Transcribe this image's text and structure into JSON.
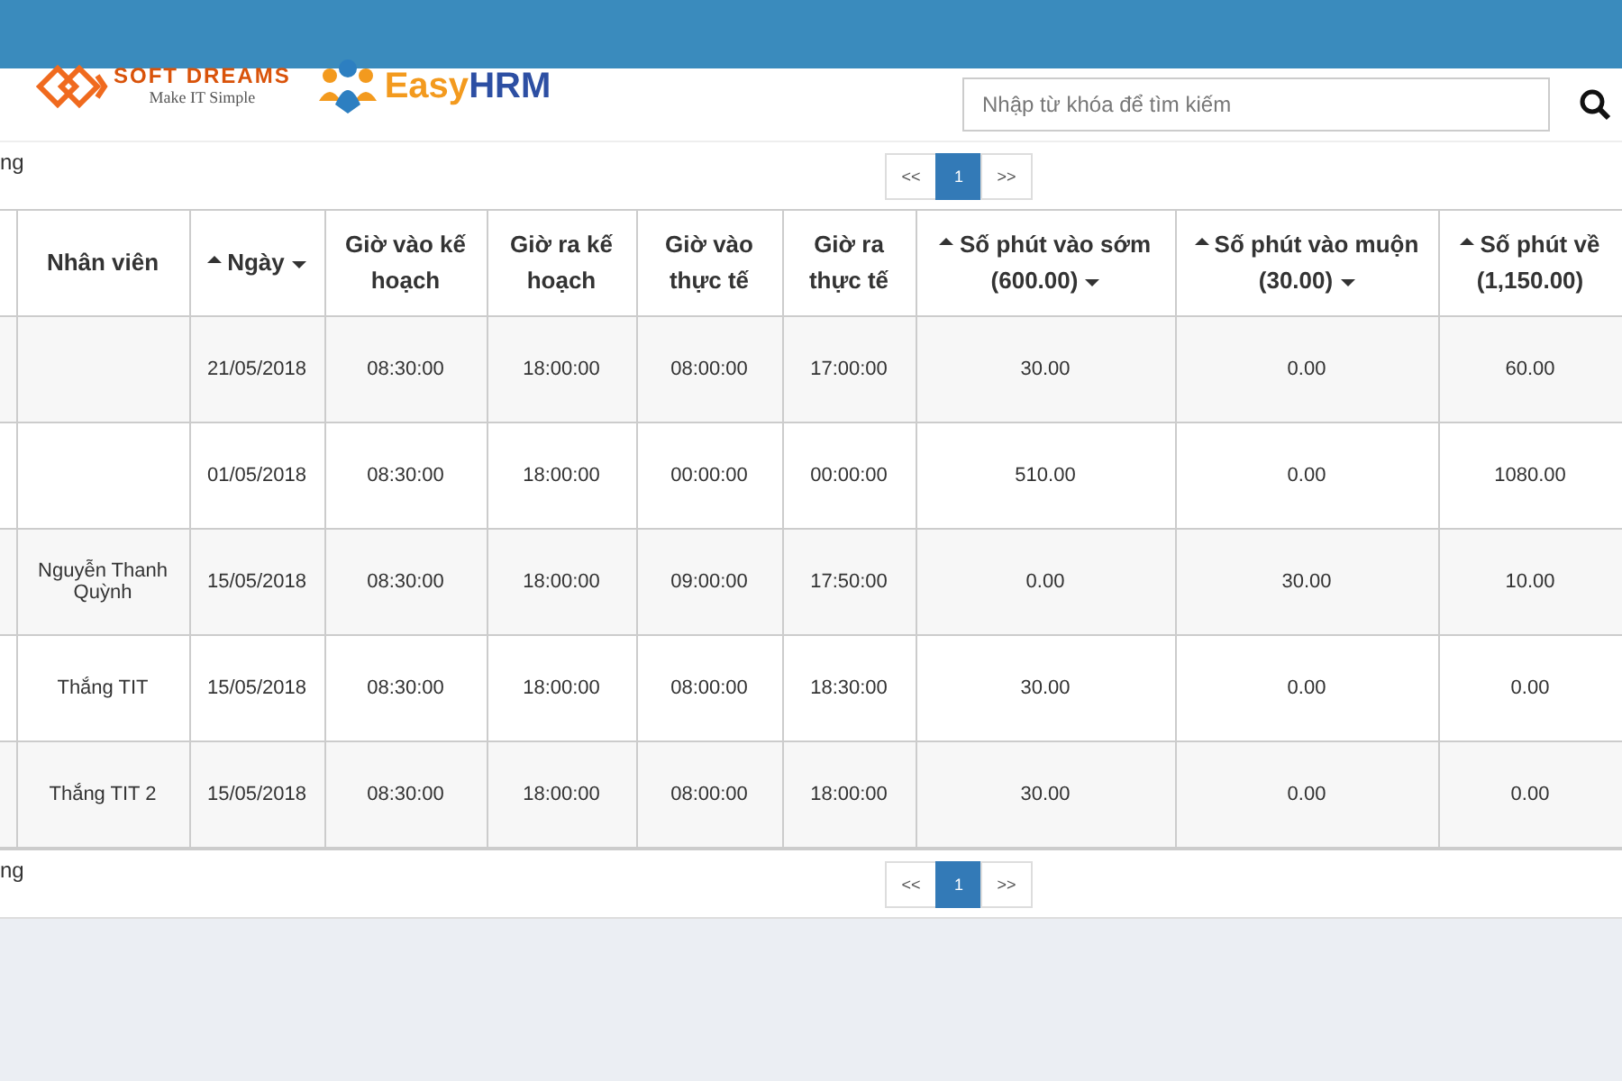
{
  "header": {
    "softdreams": {
      "name": "SOFT DREAMS",
      "tagline": "Make IT Simple"
    },
    "easyhrm": {
      "name_a": "Easy",
      "name_b": "HRM"
    }
  },
  "search": {
    "placeholder": "Nhập từ khóa để tìm kiếm"
  },
  "top_bar": {
    "status_text": "ng",
    "pagination": [
      {
        "label": "<<",
        "selected": false
      },
      {
        "label": "1",
        "selected": true
      },
      {
        "label": ">>",
        "selected": false
      }
    ]
  },
  "table": {
    "columns": [
      {
        "sort_up": false,
        "sort_down": false
      },
      {
        "label": "Nhân viên",
        "sort_up": false,
        "sort_down": false
      },
      {
        "label": "Ngày",
        "sort_up": true,
        "sort_down": true
      },
      {
        "label": "Giờ vào kế hoạch",
        "sort_up": false,
        "sort_down": false
      },
      {
        "label": "Giờ ra kế hoạch",
        "sort_up": false,
        "sort_down": false
      },
      {
        "label": "Giờ vào thực tế",
        "sort_up": false,
        "sort_down": false
      },
      {
        "label": "Giờ ra thực tế",
        "sort_up": false,
        "sort_down": false
      },
      {
        "label": "Số phút vào sớm (600.00)",
        "sort_up": true,
        "sort_down": true
      },
      {
        "label": "Số phút vào muộn (30.00)",
        "sort_up": true,
        "sort_down": true
      },
      {
        "label": "Số phút về (1,150.00)",
        "sort_up": true,
        "sort_down": false
      }
    ],
    "rows": [
      [
        "",
        "",
        "21/05/2018",
        "08:30:00",
        "18:00:00",
        "08:00:00",
        "17:00:00",
        "30.00",
        "0.00",
        "60.00"
      ],
      [
        "",
        "",
        "01/05/2018",
        "08:30:00",
        "18:00:00",
        "00:00:00",
        "00:00:00",
        "510.00",
        "0.00",
        "1080.00"
      ],
      [
        "",
        "Nguyễn Thanh Quỳnh",
        "15/05/2018",
        "08:30:00",
        "18:00:00",
        "09:00:00",
        "17:50:00",
        "0.00",
        "30.00",
        "10.00"
      ],
      [
        "",
        "Thắng TIT",
        "15/05/2018",
        "08:30:00",
        "18:00:00",
        "08:00:00",
        "18:30:00",
        "30.00",
        "0.00",
        "0.00"
      ],
      [
        "",
        "Thắng TIT 2",
        "15/05/2018",
        "08:30:00",
        "18:00:00",
        "08:00:00",
        "18:00:00",
        "30.00",
        "0.00",
        "0.00"
      ]
    ]
  },
  "bottom_bar": {
    "status_text": "ng",
    "pagination": [
      {
        "label": "<<",
        "selected": false
      },
      {
        "label": "1",
        "selected": true
      },
      {
        "label": ">>",
        "selected": false
      }
    ]
  }
}
